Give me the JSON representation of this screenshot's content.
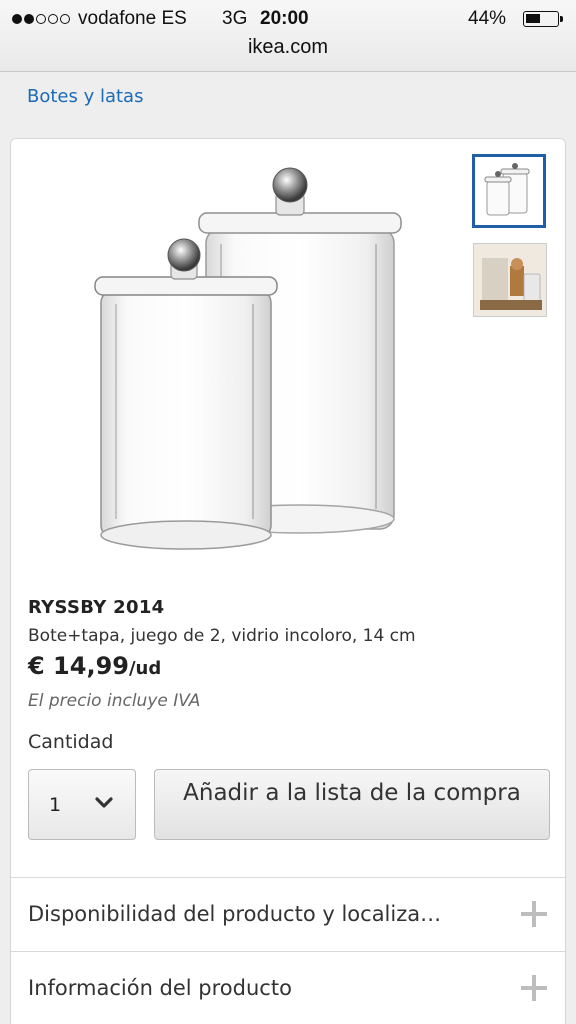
{
  "status_bar": {
    "carrier": "vodafone ES",
    "network": "3G",
    "time": "20:00",
    "battery": "44%",
    "battery_level": 0.44
  },
  "browser": {
    "url": "ikea.com"
  },
  "breadcrumb": {
    "label": "Botes y latas"
  },
  "product": {
    "name": "RYSSBY 2014",
    "description": "Bote+tapa, juego de 2, vidrio incoloro, 14 cm",
    "price": "€ 14,99",
    "price_unit": "/ud",
    "tax_note": "El precio incluye IVA",
    "quantity_label": "Cantidad",
    "quantity_value": "1",
    "add_button": "Añadir a la lista de la compra"
  },
  "accordion": [
    {
      "label": "Disponibilidad del producto y localiza…"
    },
    {
      "label": "Información del producto"
    }
  ],
  "icons": [
    "signal-dots-icon",
    "battery-icon",
    "chevron-down-icon",
    "plus-icon"
  ],
  "colors": {
    "link": "#1a6bb8",
    "thumb_selected": "#1f5fa8"
  }
}
